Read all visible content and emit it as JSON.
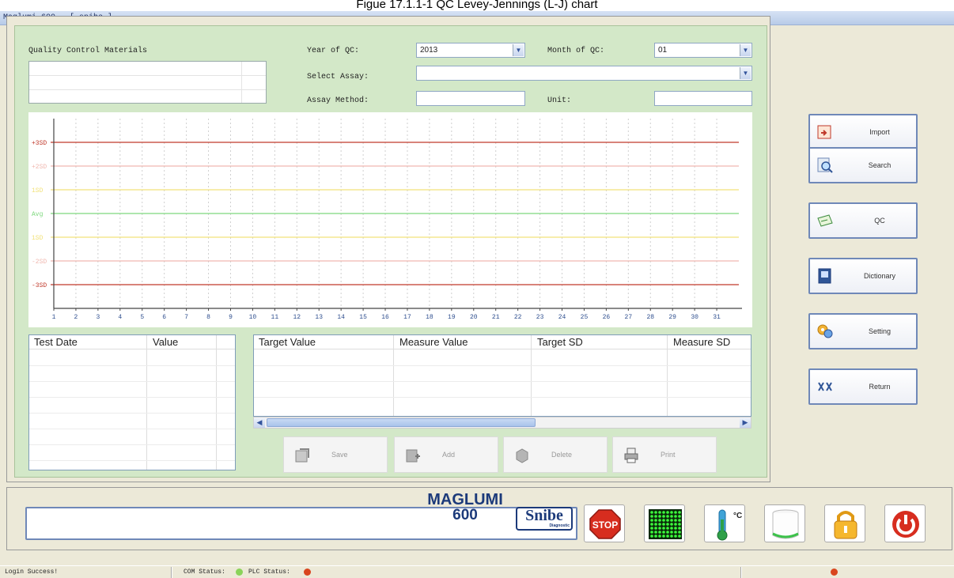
{
  "figure_caption": "Figue 17.1.1-1 QC Levey-Jennings (L-J) chart",
  "window": {
    "title": "Maglumi 600 - [ snibe ]"
  },
  "qc": {
    "materials_label": "Quality Control Materials",
    "year_label": "Year of QC:",
    "year_value": "2013",
    "month_label": "Month of QC:",
    "month_value": "01",
    "assay_label": "Select Assay:",
    "assay_value": "",
    "method_label": "Assay Method:",
    "method_value": "",
    "unit_label": "Unit:",
    "unit_value": ""
  },
  "chart_data": {
    "type": "line",
    "x": [
      "1",
      "2",
      "3",
      "4",
      "5",
      "6",
      "7",
      "8",
      "9",
      "10",
      "11",
      "12",
      "13",
      "14",
      "15",
      "16",
      "17",
      "18",
      "19",
      "20",
      "21",
      "22",
      "23",
      "24",
      "25",
      "26",
      "27",
      "28",
      "29",
      "30",
      "31"
    ],
    "control_limits": [
      {
        "label": "+3SD",
        "color": "#c0392b"
      },
      {
        "label": "+2SD",
        "color": "#f0b8b0"
      },
      {
        "label": "1SD",
        "color": "#f2e27a"
      },
      {
        "label": "Avg",
        "color": "#7dd87d"
      },
      {
        "label": "1SD",
        "color": "#f2e27a"
      },
      {
        "label": "-2SD",
        "color": "#f0b8b0"
      },
      {
        "label": "-3SD",
        "color": "#c0392b"
      }
    ],
    "series": [],
    "grid": true,
    "ylim": [
      "-3SD",
      "+3SD"
    ]
  },
  "results_table": {
    "headers": [
      "Test Date",
      "Value"
    ],
    "rows": []
  },
  "target_table": {
    "headers": [
      "Target Value",
      "Measure Value",
      "Target SD",
      "Measure SD"
    ],
    "rows": []
  },
  "actions": {
    "save": "Save",
    "add": "Add",
    "delete": "Delete",
    "print": "Print"
  },
  "side_menu": {
    "import": "Import",
    "search": "Search",
    "qc": "QC",
    "dictionary": "Dictionary",
    "setting": "Setting",
    "return": "Return"
  },
  "brand": {
    "name": "MAGLUMI",
    "model": "600",
    "logo": "Snibe",
    "logo_sub": "Diagnostic"
  },
  "tray": {
    "stop": "STOP",
    "temp_unit": "°C"
  },
  "status_bar": {
    "login": "Login Success!",
    "com_label": "COM Status:",
    "plc_label": "PLC Status:",
    "com_color": "#8ad35a",
    "plc_color": "#d9451e"
  },
  "colors": {
    "panel_green": "#d3e8c8",
    "accent_blue": "#6f88b8"
  }
}
